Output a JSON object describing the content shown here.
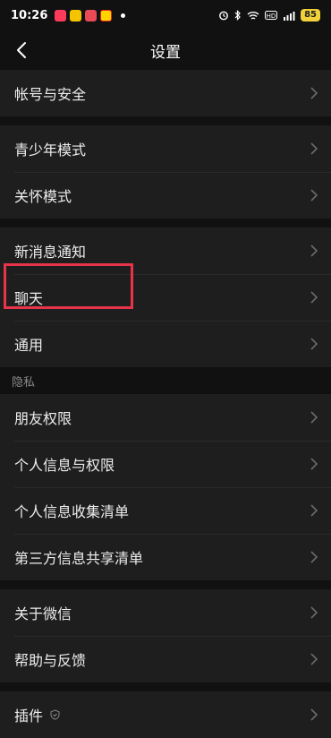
{
  "status": {
    "time": "10:26",
    "battery": "85",
    "icons": [
      "alarm-icon",
      "bluetooth-icon",
      "wifi-icon",
      "hd-icon",
      "signal-icon"
    ]
  },
  "header": {
    "title": "设置"
  },
  "groups": [
    {
      "items": [
        {
          "label": "帐号与安全"
        }
      ]
    },
    {
      "items": [
        {
          "label": "青少年模式"
        },
        {
          "label": "关怀模式"
        }
      ]
    },
    {
      "items": [
        {
          "label": "新消息通知"
        },
        {
          "label": "聊天"
        },
        {
          "label": "通用"
        }
      ]
    }
  ],
  "privacy": {
    "section_label": "隐私",
    "items": [
      {
        "label": "朋友权限"
      },
      {
        "label": "个人信息与权限"
      },
      {
        "label": "个人信息收集清单"
      },
      {
        "label": "第三方信息共享清单"
      }
    ]
  },
  "about": {
    "items": [
      {
        "label": "关于微信"
      },
      {
        "label": "帮助与反馈"
      }
    ]
  },
  "plugins": {
    "label": "插件"
  },
  "colors": {
    "background": "#111111",
    "row": "#1e1e1e",
    "highlight": "#e8344a",
    "battery": "#f1d23a"
  }
}
